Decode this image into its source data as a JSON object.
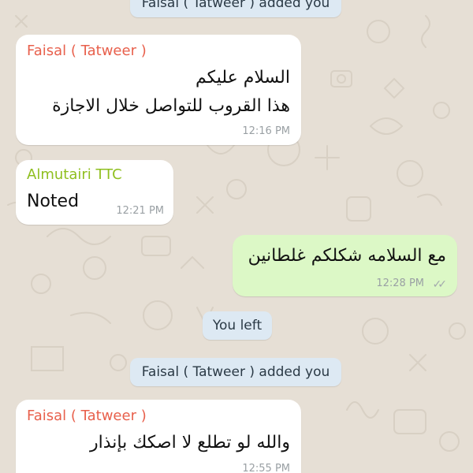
{
  "colors": {
    "wallpaper": "#e6dfd5",
    "incoming_bubble": "#ffffff",
    "outgoing_bubble": "#dcf8c6",
    "system_bubble": "#dde9f3",
    "sender_faisal": "#e8604c",
    "sender_almutairi": "#8fbf1f",
    "timestamp": "#9aa0a4"
  },
  "messages": [
    {
      "kind": "system",
      "text": "Faisal ( Tatweer ) added you"
    },
    {
      "kind": "incoming",
      "sender": "Faisal ( Tatweer )",
      "lines": [
        "السلام عليكم",
        "هذا القروب للتواصل خلال الاجازة"
      ],
      "time": "12:16 PM"
    },
    {
      "kind": "incoming",
      "sender": "Almutairi TTC",
      "lines": [
        "Noted"
      ],
      "time": "12:21 PM"
    },
    {
      "kind": "outgoing",
      "lines": [
        "مع السلامه شكلكم غلطانين"
      ],
      "time": "12:28 PM",
      "status_icon": "double-check-icon"
    },
    {
      "kind": "system",
      "text": "You left"
    },
    {
      "kind": "system",
      "text": "Faisal ( Tatweer ) added you"
    },
    {
      "kind": "incoming",
      "sender": "Faisal ( Tatweer )",
      "lines": [
        "والله لو تطلع لا اصكك بإنذار"
      ],
      "time": "12:55 PM"
    }
  ]
}
